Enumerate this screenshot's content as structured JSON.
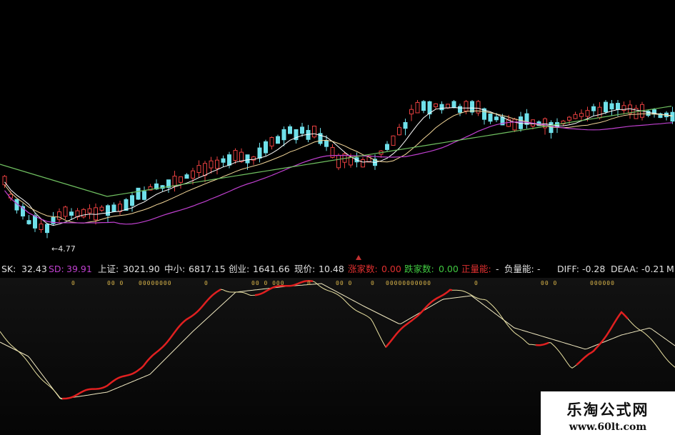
{
  "candlestick_chart": {
    "low_marker_label": "←4.77",
    "colors": {
      "up": "#e84040",
      "down": "#6fe0ea",
      "ma_short": "#ffffff",
      "ma_mid": "#f5d89a",
      "ma_purple": "#c040d0",
      "ma_long": "#6fbf60",
      "background": "#000000"
    }
  },
  "status_bar": {
    "sk_label": "SK:",
    "sk_value": "32.43",
    "sd_label": "SD:",
    "sd_value": "39.91",
    "sh_label": "上证:",
    "sh_value": "3021.90",
    "zx_label": "中小:",
    "zx_value": "6817.15",
    "cy_label": "创业:",
    "cy_value": "1641.66",
    "price_label": "现价:",
    "price_value": "10.48",
    "up_count_label": "涨家数:",
    "up_count_value": "0.00",
    "down_count_label": "跌家数:",
    "down_count_value": "0.00",
    "pos_energy_label": "正量能:",
    "pos_energy_value": "-",
    "neg_energy_label": "负量能:",
    "neg_energy_value": "-",
    "diff_label": "DIFF:",
    "diff_value": "-0.28",
    "deaa_label": "DEAA:",
    "deaa_value": "-0.21",
    "ma_label": "M"
  },
  "indicator": {
    "markers": [
      "0",
      "00  0",
      "00000000",
      "0",
      "00  0  000",
      "0",
      "00  0",
      "0",
      "00000000000",
      "0",
      "00  0",
      "000000"
    ],
    "colors": {
      "sk_line": "#e8e0a0",
      "sd_line": "#f0e8c0",
      "highlight": "#e02020",
      "marker": "#d8b44a"
    }
  },
  "watermark": {
    "title": "乐淘公式网",
    "url": "www.60lt.com"
  }
}
